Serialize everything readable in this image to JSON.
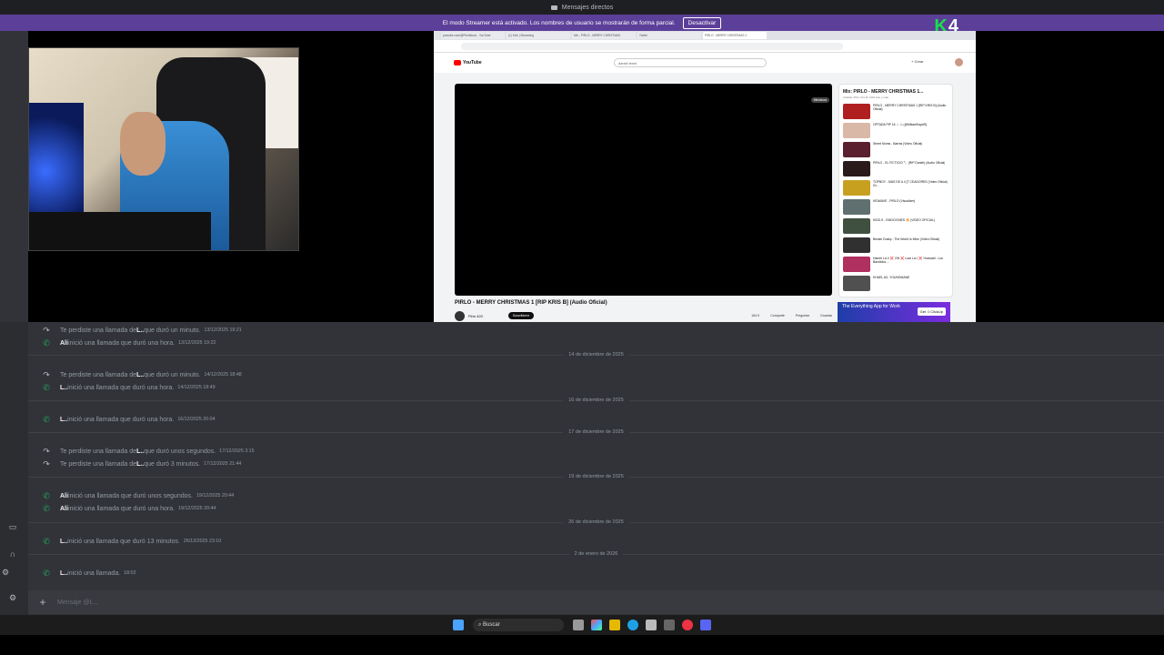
{
  "window": {
    "title": "Mensajes directos"
  },
  "streamer_banner": {
    "text": "El modo Streamer está activado. Los nombres de usuario se mostrarán de forma parcial.",
    "deactivate_label": "Desactivar"
  },
  "overlay_logo": {
    "k": "K",
    "num": "4"
  },
  "browser": {
    "tabs": [
      "youtube.com/@PirloMusic - YouTube",
      "(1) Kick | Streaming",
      "Mix - PIRLO - MERRY CHRISTMAS",
      "Twitch",
      "PIRLO - MERRY CHRISTMAS 1"
    ],
    "youtube": {
      "logo": "YouTube",
      "search_value": "daniel lenni",
      "create_label": "+ Crear",
      "miniplayer_label": "Miniatura",
      "video_title": "PIRLO - MERRY CHRISTMAS 1 [RIP KRIS B] (Audio Oficial)",
      "channel": "Pirlo 420",
      "subscribe_label": "Suscribirme",
      "actions": [
        "164 K",
        "Compartir",
        "Preguntar",
        "Guardar"
      ],
      "playlist_title": "Mix: PIRLO - MERRY CHRISTMAS 1...",
      "playlist_sub": "Artistas: Pirlo, Kris B, Kidd Keo y más",
      "playlist_items": [
        {
          "title": "PIRLO - MERRY CHRISTMAS 1 [RIP KRIS B] (Audio Oficial)",
          "color": "#b02020"
        },
        {
          "title": "OPTADA PIP 16 ☆ ⚠ (@MikaelKayaR)",
          "color": "#d9b8a8"
        },
        {
          "title": "Street Moms - Barras (Video Oficial)",
          "color": "#5a2030"
        },
        {
          "title": "PIRLO - EL FICTICIO 🔪 (RIP Daniel) (Audio Oficial)",
          "color": "#2a1a1a"
        },
        {
          "title": "TOPBOY - MÁS DE A 4 [T CEADORES (Video Oficial) Gr...",
          "color": "#c8a020"
        },
        {
          "title": "KIDWAVE - PIRLO (Visualizer)",
          "color": "#607070"
        },
        {
          "title": "KIDD.S - EMOCIONES 🔥 (VIDEO OFICIAL)",
          "color": "#405040"
        },
        {
          "title": "Bessie Dusky - The World Is Mine (Video Oficial)",
          "color": "#303030"
        },
        {
          "title": "Haneh La V ❌ ON ❌ Luar La L ❌ Hozwald - Los Bandidos ...",
          "color": "#b03060"
        },
        {
          "title": "KHAEL AX, YOUNGMANE",
          "color": "#505050"
        }
      ],
      "ad_text": "The Everything App for Work",
      "ad_button": "Get ☺ClickUp"
    }
  },
  "calls": [
    {
      "icon": "missed",
      "prefix": "Te perdiste una llamada de ",
      "who": "L..",
      "suffix": " que duró un minuto.",
      "ts": "13/12/2025 19:21"
    },
    {
      "icon": "in",
      "prefix": "",
      "who": "Ali",
      "suffix": " inició una llamada que duró una hora.",
      "ts": "13/12/2025 19:22"
    },
    {
      "sep": "14 de diciembre de 2025"
    },
    {
      "icon": "missed",
      "prefix": "Te perdiste una llamada de ",
      "who": "L..",
      "suffix": " que duró un minuto.",
      "ts": "14/12/2025 18:48"
    },
    {
      "icon": "in",
      "prefix": "",
      "who": "L..",
      "suffix": " inició una llamada que duró una hora.",
      "ts": "14/12/2025 18:49"
    },
    {
      "sep": "16 de diciembre de 2025"
    },
    {
      "icon": "in",
      "prefix": "",
      "who": "L..",
      "suffix": " inició una llamada que duró una hora.",
      "ts": "16/12/2025 20:04"
    },
    {
      "sep": "17 de diciembre de 2025"
    },
    {
      "icon": "missed",
      "prefix": "Te perdiste una llamada de ",
      "who": "L..",
      "suffix": " que duró unos segundos.",
      "ts": "17/12/2025 3:15"
    },
    {
      "icon": "missed",
      "prefix": "Te perdiste una llamada de ",
      "who": "L..",
      "suffix": " que duró 3 minutos.",
      "ts": "17/12/2025 21:44"
    },
    {
      "sep": "19 de diciembre de 2025"
    },
    {
      "icon": "in",
      "prefix": "",
      "who": "Ali",
      "suffix": " inició una llamada que duró unos segundos.",
      "ts": "19/12/2025 20:44"
    },
    {
      "icon": "in",
      "prefix": "",
      "who": "Ali",
      "suffix": " inició una llamada que duró una hora.",
      "ts": "19/12/2025 20:44"
    },
    {
      "sep": "26 de diciembre de 2025"
    },
    {
      "icon": "in",
      "prefix": "",
      "who": "L..",
      "suffix": " inició una llamada que duró 13 minutos.",
      "ts": "26/12/2025 23:10"
    },
    {
      "sep": "2 de enero de 2026"
    },
    {
      "icon": "in",
      "prefix": "",
      "who": "L..",
      "suffix": " inició una llamada.",
      "ts": "18:02"
    }
  ],
  "composer": {
    "placeholder": "Mensaje @L..."
  },
  "taskbar": {
    "search_label": "Buscar"
  },
  "colors": {
    "accent": "#5c3f99",
    "call_green": "#23a55a",
    "bg": "#313338"
  }
}
